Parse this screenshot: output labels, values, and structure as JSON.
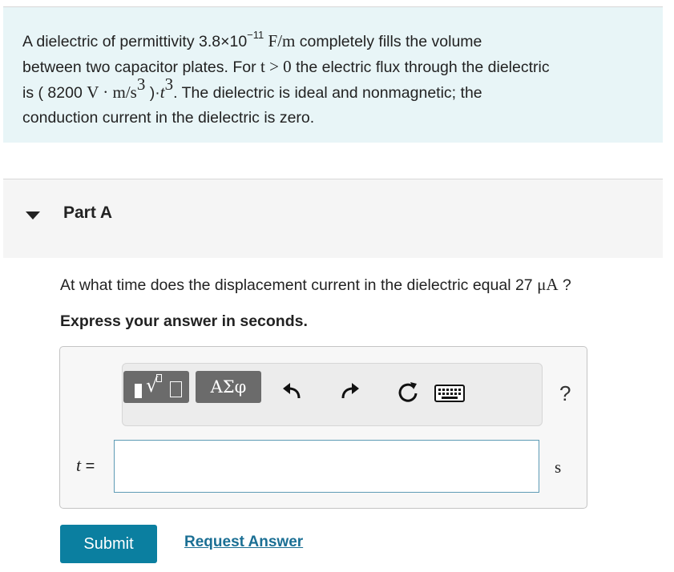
{
  "problem": {
    "t1": "A dielectric of permittivity ",
    "perm_mantissa": "3.8×10",
    "perm_exp": "−11",
    "perm_unit": " F/m",
    "t2": " completely fills the volume",
    "t3": "between two capacitor plates. For ",
    "cond": "t > 0",
    "t4": " the electric flux through the dielectric",
    "t5": "is ( 8200 ",
    "flux_unit": "V · m/s",
    "flux_unit_exp": "3",
    "t6": " )·",
    "t_var": "t",
    "t_exp": "3",
    "t7": ". The dielectric is ideal and nonmagnetic; the",
    "t8": "conduction current in the dielectric is zero."
  },
  "part": {
    "title": "Part A"
  },
  "question": {
    "text": "At what time does the displacement current in the dielectric equal 27 ",
    "unit": "μA",
    "suffix": " ?"
  },
  "instruction": "Express your answer in seconds.",
  "toolbar": {
    "greek_label": "ΑΣφ",
    "help_label": "?",
    "icons": [
      "templates-icon",
      "greek-letters-icon",
      "undo-icon",
      "redo-icon",
      "reset-icon",
      "keyboard-icon",
      "help-icon"
    ]
  },
  "answer": {
    "var_label": "t",
    "equals": " =",
    "value": "",
    "placeholder": "",
    "unit": "s"
  },
  "actions": {
    "submit_label": "Submit",
    "request_label": "Request Answer"
  },
  "colors": {
    "problem_bg": "#e8f5f7",
    "submit_bg": "#0b7fa0",
    "link": "#1b6f94",
    "input_border": "#5d9bb5"
  }
}
